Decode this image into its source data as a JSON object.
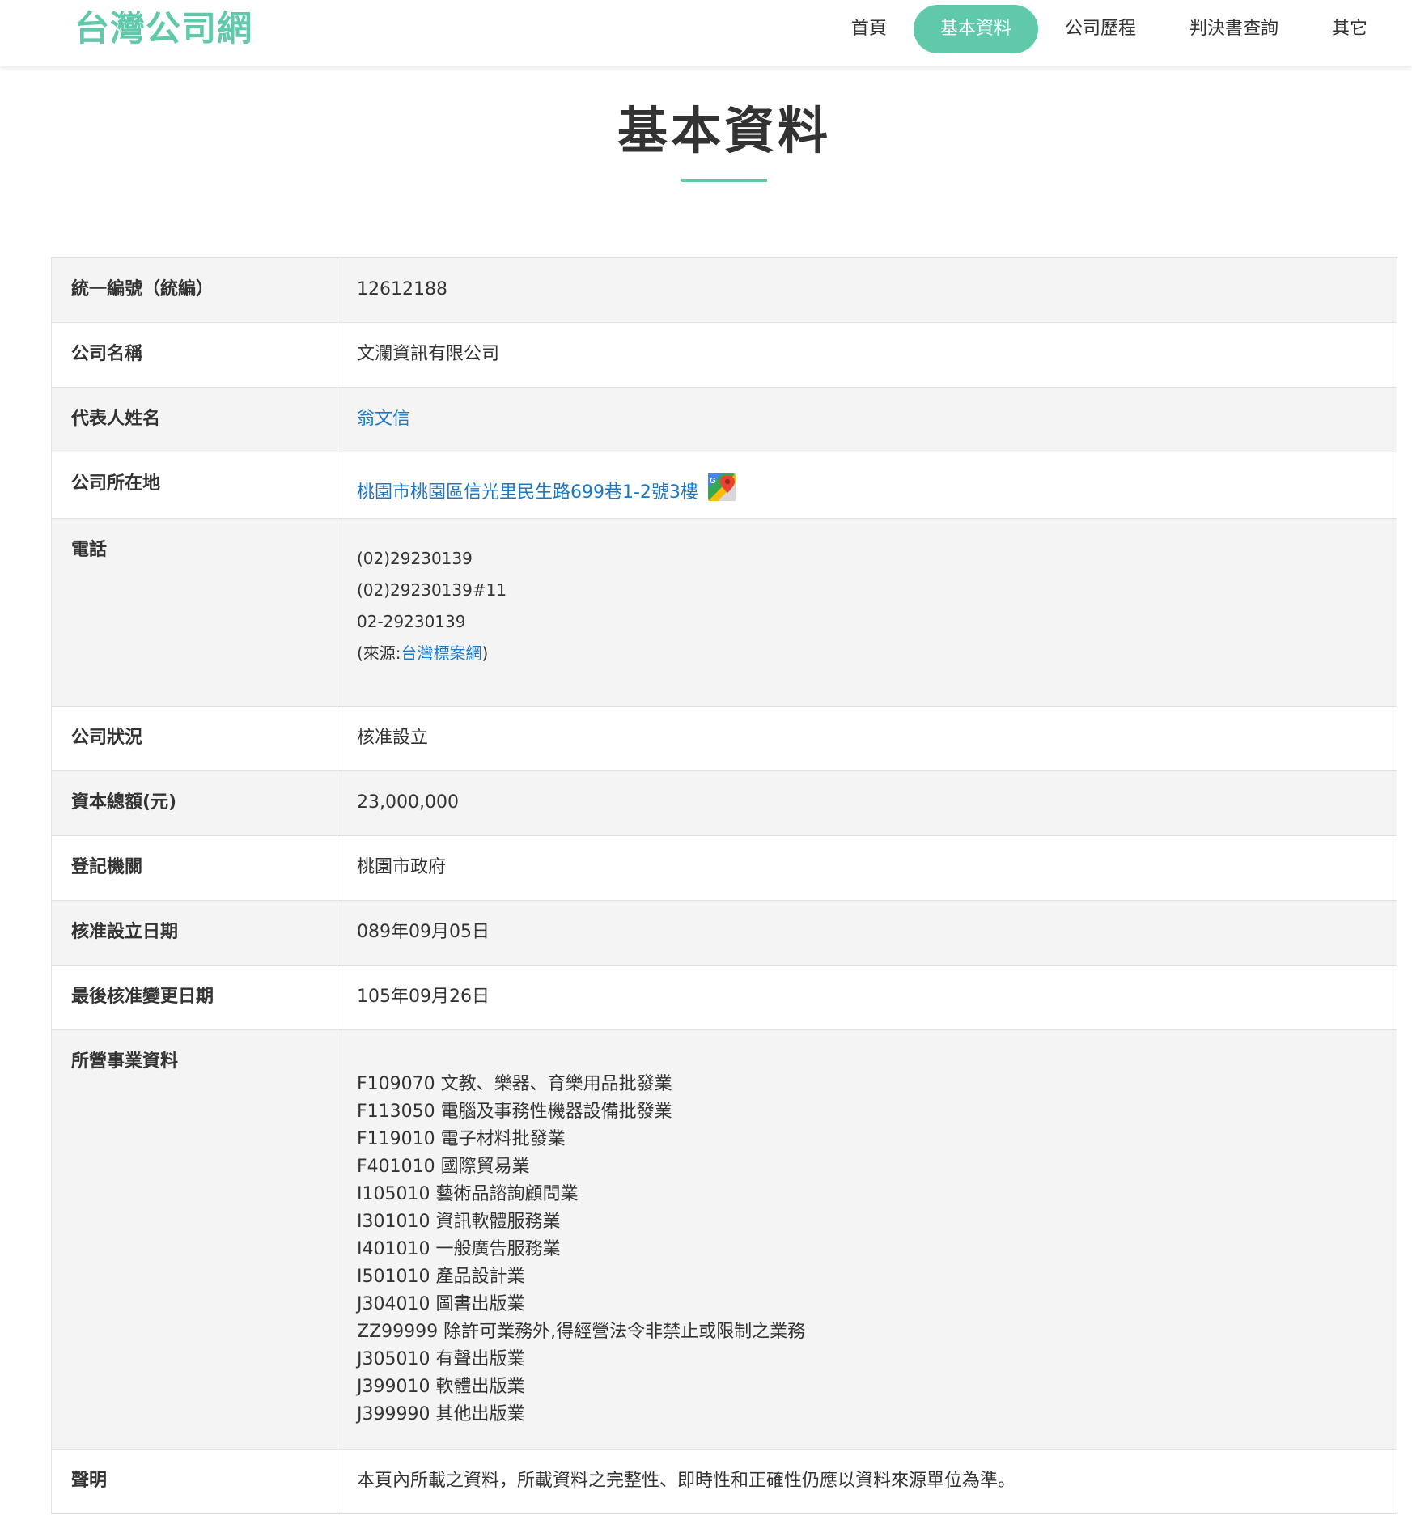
{
  "header": {
    "logo": "台灣公司網",
    "nav": [
      {
        "label": "首頁",
        "active": false
      },
      {
        "label": "基本資料",
        "active": true
      },
      {
        "label": "公司歷程",
        "active": false
      },
      {
        "label": "判決書查詢",
        "active": false
      },
      {
        "label": "其它",
        "active": false
      }
    ]
  },
  "page_title": "基本資料",
  "table": {
    "tax_id": {
      "label": "統一編號（統編）",
      "value": "12612188"
    },
    "company_name": {
      "label": "公司名稱",
      "value": "文瀾資訊有限公司"
    },
    "representative": {
      "label": "代表人姓名",
      "value": "翁文信"
    },
    "address": {
      "label": "公司所在地",
      "value": "桃園市桃園區信光里民生路699巷1-2號3樓",
      "icon": "google-maps-icon"
    },
    "phone": {
      "label": "電話",
      "numbers": [
        "(02)29230139",
        "(02)29230139#11",
        "02-29230139"
      ],
      "source_prefix": "(來源:",
      "source_link": "台灣標案網",
      "source_suffix": ")"
    },
    "status": {
      "label": "公司狀況",
      "value": "核准設立"
    },
    "capital": {
      "label": "資本總額(元)",
      "value": "23,000,000"
    },
    "registration_authority": {
      "label": "登記機關",
      "value": "桃園市政府"
    },
    "approval_date": {
      "label": "核准設立日期",
      "value": "089年09月05日"
    },
    "last_change_date": {
      "label": "最後核准變更日期",
      "value": "105年09月26日"
    },
    "business": {
      "label": "所營事業資料",
      "items": [
        "F109070 文教、樂器、育樂用品批發業",
        "F113050 電腦及事務性機器設備批發業",
        "F119010 電子材料批發業",
        "F401010 國際貿易業",
        "I105010 藝術品諮詢顧問業",
        "I301010 資訊軟體服務業",
        "I401010 一般廣告服務業",
        "I501010 產品設計業",
        "J304010 圖書出版業",
        "ZZ99999 除許可業務外,得經營法令非禁止或限制之業務",
        "J305010 有聲出版業",
        "J399010 軟體出版業",
        "J399990 其他出版業"
      ]
    },
    "disclaimer": {
      "label": "聲明",
      "value": "本頁內所載之資料，所載資料之完整性、即時性和正確性仍應以資料來源單位為準。"
    }
  },
  "colors": {
    "accent": "#5fc9aa",
    "link": "#1a78c8",
    "row_grey": "#f4f4f4"
  }
}
